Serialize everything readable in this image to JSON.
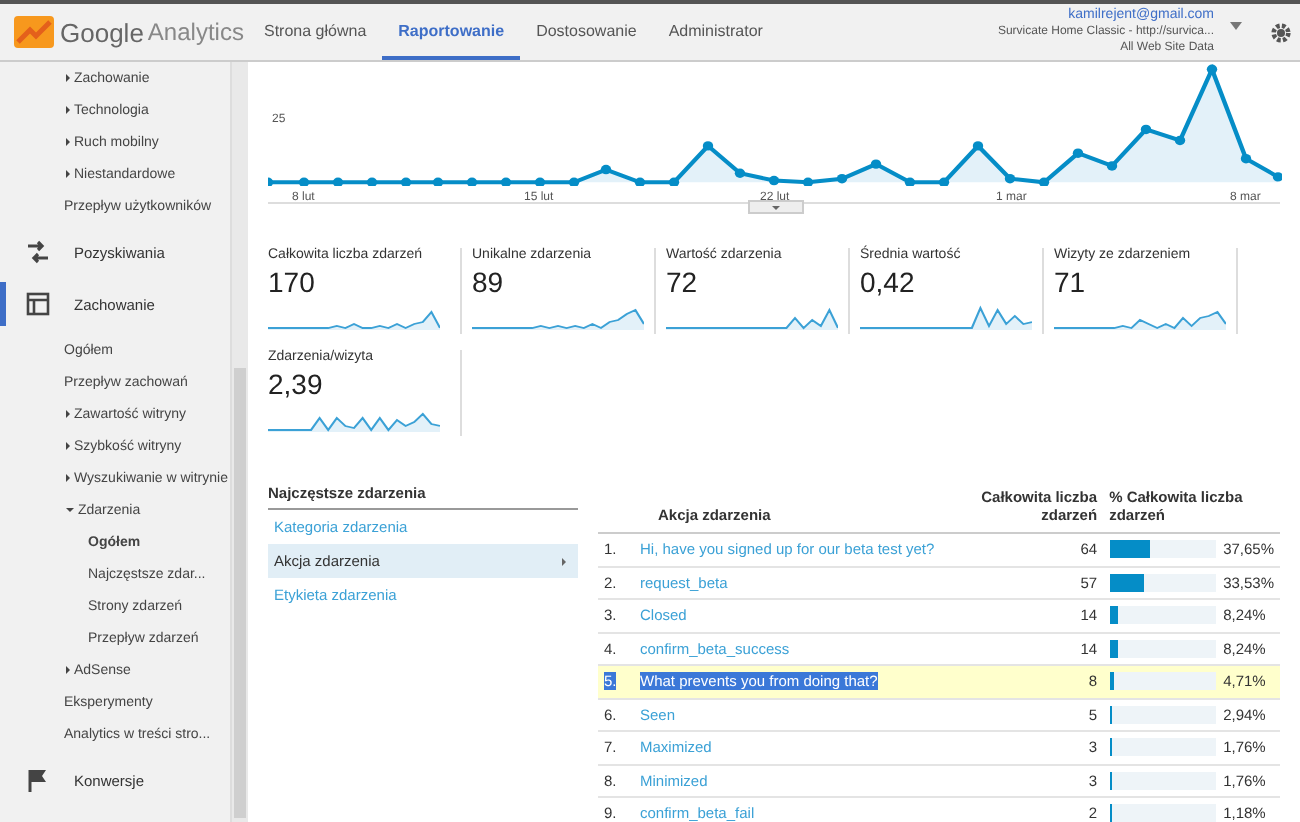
{
  "header": {
    "logo_text": "Google",
    "product": "Analytics",
    "tabs": [
      {
        "label": "Strona główna",
        "selected": false
      },
      {
        "label": "Raportowanie",
        "selected": true
      },
      {
        "label": "Dostosowanie",
        "selected": false
      },
      {
        "label": "Administrator",
        "selected": false
      }
    ],
    "account": {
      "email": "kamilrejent@gmail.com",
      "property": "Survicate Home Classic - http://survica...",
      "view": "All Web Site Data"
    }
  },
  "sidebar": {
    "sections": [
      {
        "kind": "continued",
        "children": [
          {
            "label": "Zachowanie",
            "expanded": false,
            "selected": false
          },
          {
            "label": "Technologia",
            "expanded": false,
            "selected": false
          },
          {
            "label": "Ruch mobilny",
            "expanded": false,
            "selected": false
          },
          {
            "label": "Niestandardowe",
            "expanded": false,
            "selected": false
          },
          {
            "label": "Przepływ użytkowników",
            "selected": false
          }
        ]
      },
      {
        "kind": "section",
        "label": "Pozyskiwania",
        "selected": false
      },
      {
        "kind": "section",
        "label": "Zachowanie",
        "selected": true,
        "children": [
          {
            "label": "Ogółem",
            "selected": false
          },
          {
            "label": "Przepływ zachowań",
            "selected": false
          },
          {
            "label": "Zawartość witryny",
            "expanded": false,
            "selected": false
          },
          {
            "label": "Szybkość witryny",
            "expanded": false,
            "selected": false
          },
          {
            "label": "Wyszukiwanie w witrynie",
            "expanded": false,
            "selected": false
          },
          {
            "label": "Zdarzenia",
            "expanded": true,
            "selected": false,
            "children": [
              {
                "label": "Ogółem",
                "selected": true
              },
              {
                "label": "Najczęstsze zdar...",
                "selected": false
              },
              {
                "label": "Strony zdarzeń",
                "selected": false
              },
              {
                "label": "Przepływ zdarzeń",
                "selected": false
              }
            ]
          },
          {
            "label": "AdSense",
            "expanded": false,
            "selected": false
          },
          {
            "label": "Eksperymenty",
            "selected": false
          },
          {
            "label": "Analytics w treści stro...",
            "selected": false
          }
        ]
      },
      {
        "kind": "section",
        "label": "Konwersje",
        "selected": false
      }
    ]
  },
  "chart": {
    "y_label": "25",
    "x_labels": [
      "8 lut",
      "15 lut",
      "22 lut",
      "1 mar",
      "8 mar"
    ]
  },
  "metrics": [
    {
      "label": "Całkowita liczba zdarzeń",
      "value": "170"
    },
    {
      "label": "Unikalne zdarzenia",
      "value": "89"
    },
    {
      "label": "Wartość zdarzenia",
      "value": "72"
    },
    {
      "label": "Średnia wartość",
      "value": "0,42"
    },
    {
      "label": "Wizyty ze zdarzeniem",
      "value": "71"
    },
    {
      "label": "Zdarzenia/wizyta",
      "value": "2,39"
    }
  ],
  "top_events": {
    "title": "Najczęstsze zdarzenia",
    "options": [
      {
        "label": "Kategoria zdarzenia",
        "selected": false
      },
      {
        "label": "Akcja zdarzenia",
        "selected": true
      },
      {
        "label": "Etykieta zdarzenia",
        "selected": false
      }
    ]
  },
  "table": {
    "columns": [
      "Akcja zdarzenia",
      "Całkowita liczba zdarzeń",
      "% Całkowita liczba zdarzeń"
    ],
    "rows": [
      {
        "rank": "1.",
        "label": "Hi, have you signed up for our beta test yet?",
        "count": "64",
        "level": 0.3765,
        "percent": "37,65%",
        "highlighted": false
      },
      {
        "rank": "2.",
        "label": "request_beta",
        "count": "57",
        "level": 0.3353,
        "percent": "33,53%",
        "highlighted": false
      },
      {
        "rank": "3.",
        "label": "Closed",
        "count": "14",
        "level": 0.0824,
        "percent": "8,24%",
        "highlighted": false
      },
      {
        "rank": "4.",
        "label": "confirm_beta_success",
        "count": "14",
        "level": 0.0824,
        "percent": "8,24%",
        "highlighted": false
      },
      {
        "rank": "5.",
        "label": "What prevents you from doing that?",
        "count": "8",
        "level": 0.0471,
        "percent": "4,71%",
        "highlighted": true
      },
      {
        "rank": "6.",
        "label": "Seen",
        "count": "5",
        "level": 0.0294,
        "percent": "2,94%",
        "highlighted": false
      },
      {
        "rank": "7.",
        "label": "Maximized",
        "count": "3",
        "level": 0.0176,
        "percent": "1,76%",
        "highlighted": false
      },
      {
        "rank": "8.",
        "label": "Minimized",
        "count": "3",
        "level": 0.0176,
        "percent": "1,76%",
        "highlighted": false
      },
      {
        "rank": "9.",
        "label": "confirm_beta_fail",
        "count": "2",
        "level": 0.0118,
        "percent": "1,18%",
        "highlighted": false
      }
    ]
  }
}
